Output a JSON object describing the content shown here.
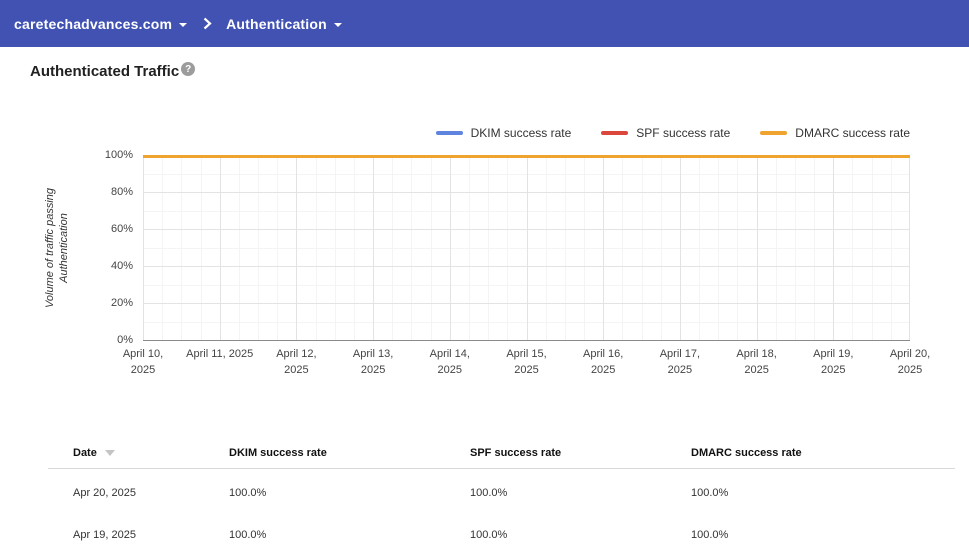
{
  "topbar": {
    "domain_label": "caretechadvances.com",
    "section_label": "Authentication"
  },
  "page": {
    "title": "Authenticated Traffic",
    "help_icon": "?"
  },
  "chart_data": {
    "type": "line",
    "title": "Authenticated Traffic",
    "x": [
      "April 10, 2025",
      "April 11, 2025",
      "April 12, 2025",
      "April 13, 2025",
      "April 14, 2025",
      "April 15, 2025",
      "April 16, 2025",
      "April 17, 2025",
      "April 18, 2025",
      "April 19, 2025",
      "April 20, 2025"
    ],
    "xticklabel_lines": [
      [
        "April 10,",
        "2025"
      ],
      [
        "April 11, 2025"
      ],
      [
        "April 12,",
        "2025"
      ],
      [
        "April 13,",
        "2025"
      ],
      [
        "April 14,",
        "2025"
      ],
      [
        "April 15,",
        "2025"
      ],
      [
        "April 16,",
        "2025"
      ],
      [
        "April 17,",
        "2025"
      ],
      [
        "April 18,",
        "2025"
      ],
      [
        "April 19,",
        "2025"
      ],
      [
        "April 20,",
        "2025"
      ]
    ],
    "ylabel_lines": [
      "Volume of traffic passing",
      "Authentication"
    ],
    "ylim": [
      0,
      100
    ],
    "yticks": [
      0,
      20,
      40,
      60,
      80,
      100
    ],
    "ytick_suffix": "%",
    "grid": true,
    "legend_position": "top-right",
    "series": [
      {
        "name": "DKIM success rate",
        "color": "#5e84e0",
        "values": [
          100,
          100,
          100,
          100,
          100,
          100,
          100,
          100,
          100,
          100,
          100
        ]
      },
      {
        "name": "SPF success rate",
        "color": "#db473c",
        "values": [
          100,
          100,
          100,
          100,
          100,
          100,
          100,
          100,
          100,
          100,
          100
        ]
      },
      {
        "name": "DMARC success rate",
        "color": "#f0a430",
        "values": [
          100,
          100,
          100,
          100,
          100,
          100,
          100,
          100,
          100,
          100,
          100
        ]
      }
    ],
    "colors": {
      "grid_major": "#e3e3e3",
      "grid_minor": "#f4f4f4",
      "baseline": "#8a8a8a"
    }
  },
  "table": {
    "columns": [
      "Date",
      "DKIM success rate",
      "SPF success rate",
      "DMARC success rate"
    ],
    "sort": {
      "column": "Date",
      "direction": "desc"
    },
    "rows": [
      [
        "Apr 20, 2025",
        "100.0%",
        "100.0%",
        "100.0%"
      ],
      [
        "Apr 19, 2025",
        "100.0%",
        "100.0%",
        "100.0%"
      ]
    ]
  }
}
